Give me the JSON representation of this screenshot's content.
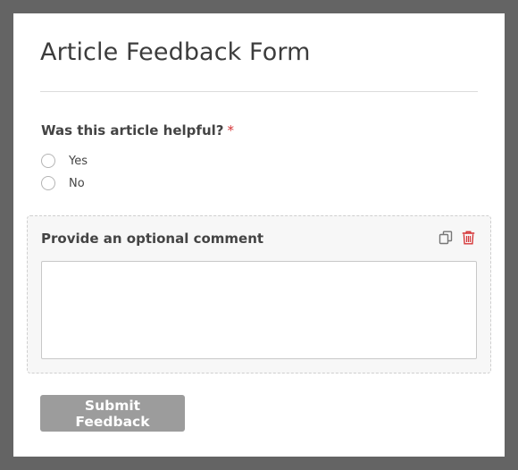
{
  "form": {
    "title": "Article Feedback Form",
    "question": {
      "label": "Was this article helpful?",
      "required_marker": "*",
      "options": [
        {
          "label": "Yes",
          "selected": false
        },
        {
          "label": "No",
          "selected": false
        }
      ]
    },
    "comment": {
      "label": "Provide an optional comment",
      "value": "",
      "actions": [
        {
          "icon": "duplicate-icon"
        },
        {
          "icon": "trash-icon",
          "color": "#d63638"
        }
      ]
    },
    "submit_label": "Submit Feedback"
  },
  "colors": {
    "backdrop": "#646464",
    "panel": "#ffffff",
    "required": "#d63638",
    "field_background": "#f7f7f7",
    "button": "#9c9c9c",
    "button_text": "#ffffff"
  }
}
